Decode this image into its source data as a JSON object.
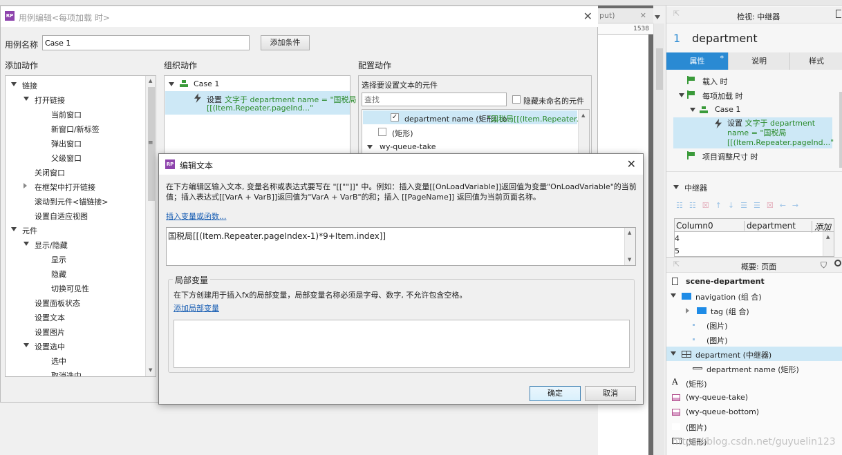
{
  "colors": {
    "accent": "#2a8ad3",
    "green": "#2a8a2a",
    "selection": "#cde8f6",
    "link": "#1a5fb4"
  },
  "case_dialog": {
    "title": "用例编辑<每项加载 时>",
    "case_name_label": "用例名称",
    "case_name_value": "Case 1",
    "add_condition": "添加条件",
    "add_action_header": "添加动作",
    "organize_header": "组织动作",
    "configure_header": "配置动作",
    "actions": [
      {
        "label": "链接",
        "level": 0,
        "exp": "open"
      },
      {
        "label": "打开链接",
        "level": 1,
        "exp": "open"
      },
      {
        "label": "当前窗口",
        "level": 2,
        "exp": ""
      },
      {
        "label": "新窗口/新标签",
        "level": 2,
        "exp": ""
      },
      {
        "label": "弹出窗口",
        "level": 2,
        "exp": ""
      },
      {
        "label": "父级窗口",
        "level": 2,
        "exp": ""
      },
      {
        "label": "关闭窗口",
        "level": 1,
        "exp": ""
      },
      {
        "label": "在框架中打开链接",
        "level": 1,
        "exp": "closed"
      },
      {
        "label": "滚动到元件<锚链接>",
        "level": 1,
        "exp": ""
      },
      {
        "label": "设置自适应视图",
        "level": 1,
        "exp": ""
      },
      {
        "label": "元件",
        "level": 0,
        "exp": "open"
      },
      {
        "label": "显示/隐藏",
        "level": 1,
        "exp": "open"
      },
      {
        "label": "显示",
        "level": 2,
        "exp": ""
      },
      {
        "label": "隐藏",
        "level": 2,
        "exp": ""
      },
      {
        "label": "切换可见性",
        "level": 2,
        "exp": ""
      },
      {
        "label": "设置面板状态",
        "level": 1,
        "exp": ""
      },
      {
        "label": "设置文本",
        "level": 1,
        "exp": ""
      },
      {
        "label": "设置图片",
        "level": 1,
        "exp": ""
      },
      {
        "label": "设置选中",
        "level": 1,
        "exp": "open"
      },
      {
        "label": "选中",
        "level": 2,
        "exp": ""
      },
      {
        "label": "取消选中",
        "level": 2,
        "exp": ""
      }
    ],
    "organize": {
      "case_label": "Case 1",
      "action_prefix": "设置 ",
      "action_text_1": "文字于 department name = \"国税局",
      "action_text_2": "[[(Item.Repeater.pageInd...\""
    },
    "configure": {
      "select_label": "选择要设置文本的元件",
      "search_placeholder": "查找",
      "hide_unnamed": "隐藏未命名的元件",
      "rows": [
        {
          "label": "department name (矩形) to ",
          "value": "\"国税局[[(Item.Repeater.p",
          "checked": true
        },
        {
          "label": "(矩形)",
          "value": "",
          "checked": false
        },
        {
          "label": "wy-queue-take",
          "value": "",
          "checked": false
        }
      ]
    }
  },
  "edit_text": {
    "title": "编辑文本",
    "description": "在下方编辑区输入文本, 变量名称或表达式要写在 \"[[\"\"]]\" 中。例如：插入变量[[OnLoadVariable]]返回值为变量\"OnLoadVariable\"的当前值；插入表达式[[VarA + VarB]]返回值为\"VarA + VarB\"的和；插入 [[PageName]] 返回值为当前页面名称。",
    "insert_link": "插入变量或函数...",
    "text_value": "国税局[[(Item.Repeater.pageIndex-1)*9+Item.index]]",
    "local_vars_legend": "局部变量",
    "local_vars_desc": "在下方创建用于插入fx的局部变量，局部变量名称必须是字母、数字, 不允许包含空格。",
    "add_local_var": "添加局部变量",
    "ok": "确定",
    "cancel": "取消"
  },
  "background": {
    "tab_fragment": "put)",
    "ruler_value": "1538"
  },
  "inspector": {
    "header": "检视: 中继器",
    "index": "1",
    "name": "department",
    "tabs": [
      {
        "label": "属性",
        "active": true,
        "star": "*"
      },
      {
        "label": "说明",
        "active": false,
        "star": ""
      },
      {
        "label": "样式",
        "active": false,
        "star": ""
      }
    ],
    "events": {
      "onload": "载入 时",
      "item_load": "每项加载 时",
      "case": "Case 1",
      "action_prefix": "设置 ",
      "action_text": "文字于 department name = \"国税局 [[(Item.Repeater.pageInd...\"",
      "resize": "项目调整尺寸 时"
    },
    "repeater_header": "中继器",
    "grid_columns": [
      "Column0",
      "department",
      "添加"
    ],
    "grid_rows": [
      "4",
      "5"
    ]
  },
  "outline": {
    "header": "概要: 页面",
    "items": [
      {
        "label": "scene-department",
        "level": 0,
        "icon": "page",
        "exp": "",
        "bold": true,
        "sel": false
      },
      {
        "label": "navigation (组 合)",
        "level": 0,
        "icon": "folder",
        "exp": "open",
        "bold": false,
        "sel": false
      },
      {
        "label": "tag (组 合)",
        "level": 1,
        "icon": "folder",
        "exp": "closed",
        "bold": false,
        "sel": false
      },
      {
        "label": "(图片)",
        "level": 1,
        "icon": "dot",
        "exp": "",
        "bold": false,
        "sel": false
      },
      {
        "label": "(图片)",
        "level": 1,
        "icon": "dot",
        "exp": "",
        "bold": false,
        "sel": false
      },
      {
        "label": "department (中继器)",
        "level": 0,
        "icon": "grid",
        "exp": "open",
        "bold": false,
        "sel": true
      },
      {
        "label": "department name (矩形)",
        "level": 1,
        "icon": "line",
        "exp": "",
        "bold": false,
        "sel": false
      },
      {
        "label": "(矩形)",
        "level": 0,
        "icon": "A",
        "exp": "",
        "bold": false,
        "sel": false
      },
      {
        "label": "(wy-queue-take)",
        "level": 0,
        "icon": "pink",
        "exp": "",
        "bold": false,
        "sel": false
      },
      {
        "label": "(wy-queue-bottom)",
        "level": 0,
        "icon": "pink",
        "exp": "",
        "bold": false,
        "sel": false
      },
      {
        "label": "(图片)",
        "level": 0,
        "icon": "blank",
        "exp": "",
        "bold": false,
        "sel": false
      },
      {
        "label": "(矩形)",
        "level": 0,
        "icon": "rect",
        "exp": "",
        "bold": false,
        "sel": false
      }
    ],
    "watermark": "https://blog.csdn.net/guyuelin123"
  }
}
